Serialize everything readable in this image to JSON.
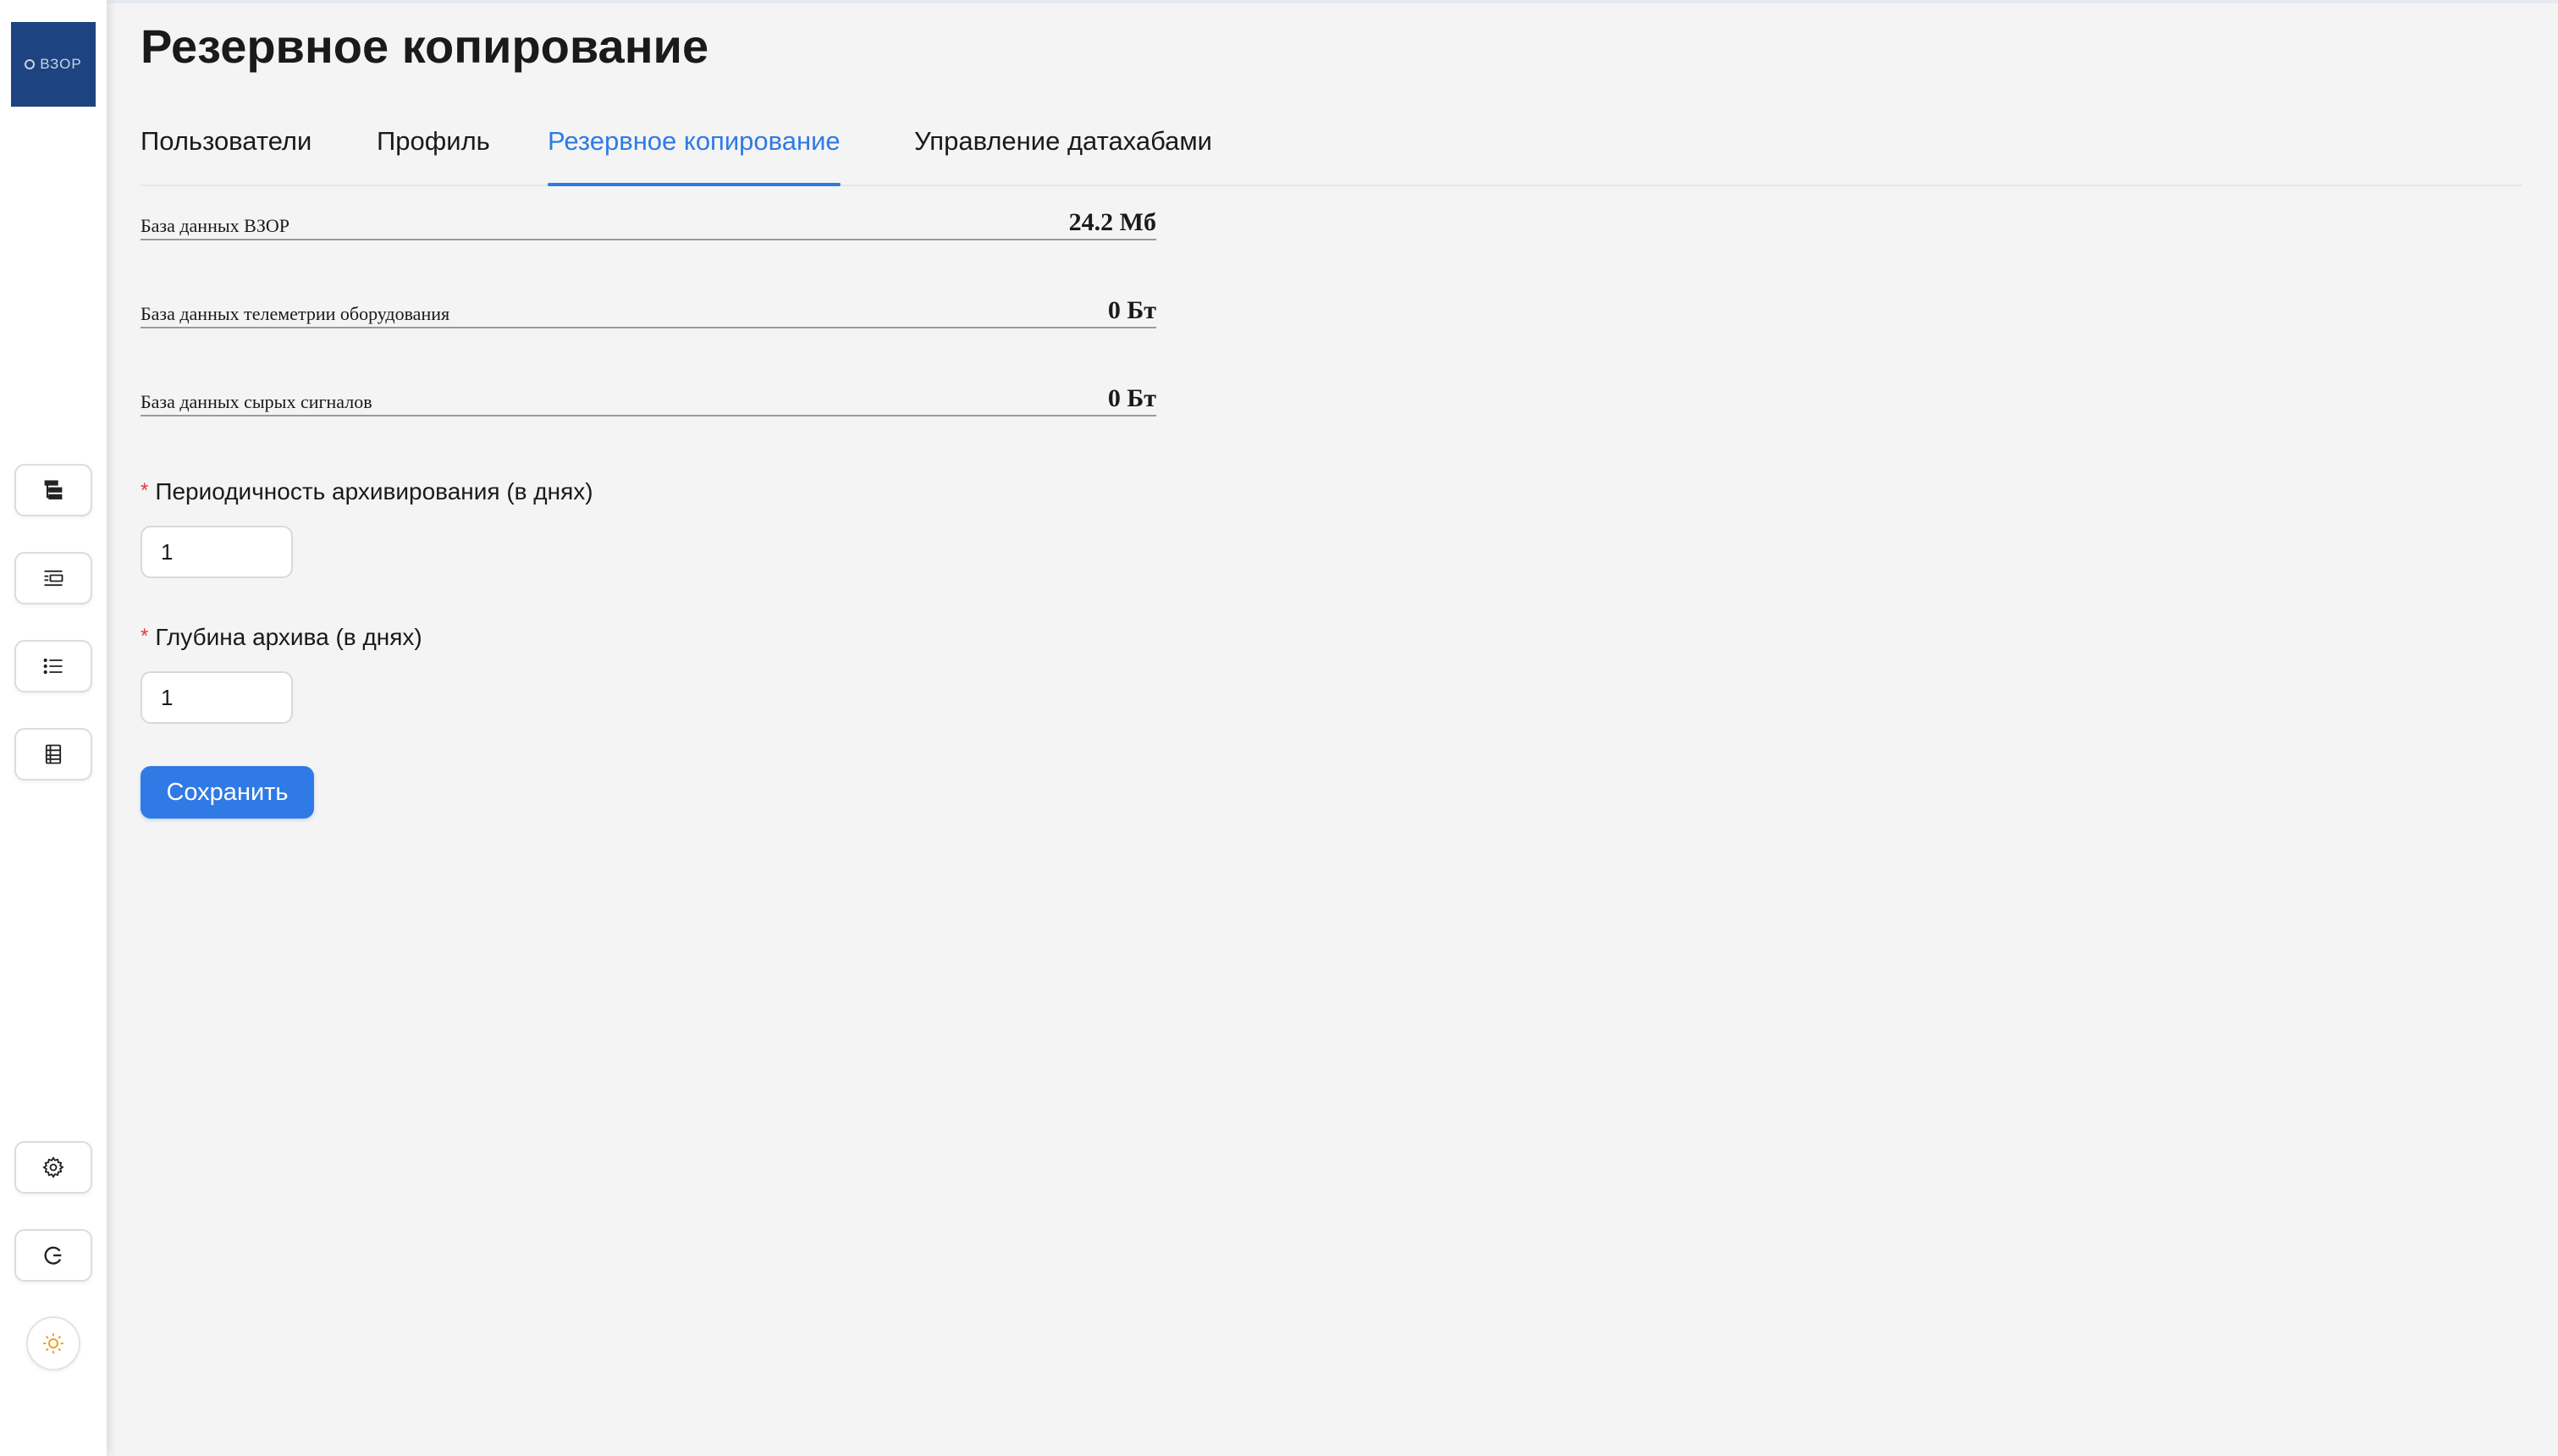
{
  "brand": {
    "logo_text": "ВЗОР"
  },
  "sidebar": {
    "items": [
      {
        "icon": "hierarchy-icon"
      },
      {
        "icon": "list-indent-icon"
      },
      {
        "icon": "bullet-list-icon"
      },
      {
        "icon": "ledger-icon"
      }
    ],
    "bottom": [
      {
        "icon": "gear-icon"
      },
      {
        "icon": "logout-icon"
      },
      {
        "icon": "sun-icon"
      }
    ]
  },
  "header": {
    "title": "Резервное копирование"
  },
  "tabs": [
    {
      "label": "Пользователи"
    },
    {
      "label": "Профиль"
    },
    {
      "label": "Резервное копирование",
      "active": true
    },
    {
      "label": "Управление датахабами"
    }
  ],
  "databases": [
    {
      "label": "База данных ВЗОР",
      "size": "24.2 Мб"
    },
    {
      "label": "База данных телеметрии оборудования",
      "size": "0 Бт"
    },
    {
      "label": "База данных сырых сигналов",
      "size": "0 Бт"
    }
  ],
  "form": {
    "period": {
      "required_mark": "*",
      "label": "Периодичность архивирования (в днях)",
      "value": "1"
    },
    "depth": {
      "required_mark": "*",
      "label": "Глубина архива (в днях)",
      "value": "1"
    },
    "save_label": "Сохранить"
  },
  "colors": {
    "accent": "#2f7ae5",
    "logo_bg": "#1d4380",
    "required": "#e53935",
    "sun": "#f0a020"
  }
}
